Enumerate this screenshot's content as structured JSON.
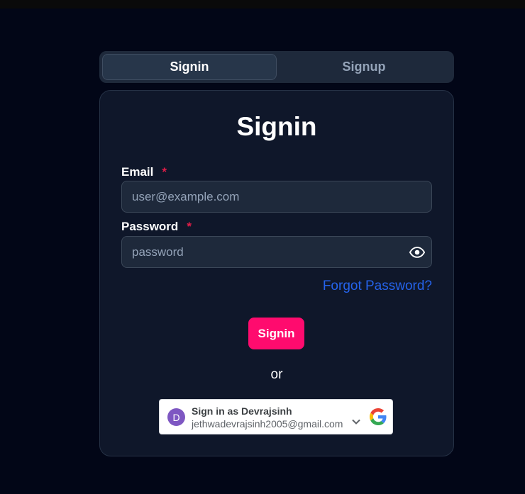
{
  "tabs": [
    {
      "label": "Signin",
      "active": true
    },
    {
      "label": "Signup",
      "active": false
    }
  ],
  "form": {
    "title": "Signin",
    "email": {
      "label": "Email",
      "required_mark": "*",
      "placeholder": "user@example.com",
      "value": ""
    },
    "password": {
      "label": "Password",
      "required_mark": "*",
      "placeholder": "password",
      "value": ""
    },
    "forgot_link": "Forgot Password?",
    "submit_label": "Signin",
    "divider_text": "or"
  },
  "google": {
    "avatar_letter": "D",
    "title": "Sign in as Devrajsinh",
    "email": "jethwadevrajsinh2005@gmail.com"
  },
  "colors": {
    "background": "#020617",
    "card": "#0f172a",
    "accent": "#ff0b6e",
    "link": "#2563eb",
    "required": "#e11d48",
    "avatar": "#7e57c2"
  },
  "icons": [
    "eye-icon",
    "chevron-down-icon",
    "google-logo-icon"
  ]
}
